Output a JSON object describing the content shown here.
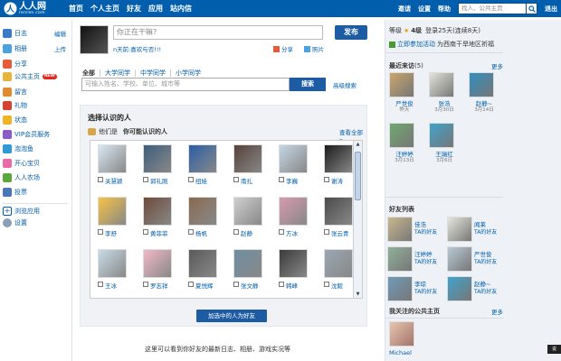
{
  "topbar": {
    "logo_text": "人人网",
    "logo_sub": "renren.com",
    "nav": [
      "首页",
      "个人主页",
      "好友",
      "应用",
      "站内信"
    ],
    "right_links": [
      "邀请",
      "设置",
      "帮助"
    ],
    "search_placeholder": "找人、公共主页",
    "logout": "退出"
  },
  "sidebar": {
    "edit": "编辑",
    "upload": "上传",
    "items": [
      {
        "label": "日志",
        "icon": "blog-icon",
        "color": "#3a79c9"
      },
      {
        "label": "相册",
        "icon": "album-icon",
        "color": "#4aa3df"
      },
      {
        "label": "分享",
        "icon": "share-icon",
        "color": "#e55c3a"
      },
      {
        "label": "公共主页",
        "icon": "page-icon",
        "color": "#e8b33a",
        "badge": "NEW"
      },
      {
        "label": "留言",
        "icon": "message-icon",
        "color": "#e58a2c"
      },
      {
        "label": "礼物",
        "icon": "gift-icon",
        "color": "#d8412f"
      },
      {
        "label": "状态",
        "icon": "status-icon",
        "color": "#f0b323"
      },
      {
        "label": "VIP会员服务",
        "icon": "vip-icon",
        "color": "#8b5bc9"
      },
      {
        "label": "泡泡鱼",
        "icon": "fish-icon",
        "color": "#2f98d6"
      },
      {
        "label": "开心宝贝",
        "icon": "baby-icon",
        "color": "#e86aa7"
      },
      {
        "label": "人人农场",
        "icon": "farm-icon",
        "color": "#5aa83b"
      },
      {
        "label": "投票",
        "icon": "vote-icon",
        "color": "#4a76b8"
      }
    ],
    "bottom_items": [
      {
        "label": "浏览应用",
        "icon": "browse-apps-icon"
      },
      {
        "label": "设置",
        "icon": "settings-icon"
      }
    ]
  },
  "main": {
    "status_placeholder": "你正在干嘛?",
    "status_line": "n天前:喜欢与否!!!",
    "publish": "发布",
    "share": "分享",
    "photo": "照片",
    "tabs": [
      "全部",
      "大学同学",
      "中学同学",
      "小学同学"
    ],
    "search_placeholder": "可输入姓名、学校、单位、城市等",
    "search_btn": "搜索",
    "advanced": "高级搜索",
    "panel_title": "选择认识的人",
    "panel_sub_a": "他们是",
    "panel_sub_b": "你可能认识的人",
    "see_all": "查看全部 »",
    "people": [
      "关慧颖",
      "郭礼刚",
      "纽娃",
      "南扎",
      "李巍",
      "谢涛",
      "李舒",
      "黄菲菲",
      "杨帆",
      "赵静",
      "方冰",
      "张云青",
      "王冰",
      "罗志祥",
      "夏悦辉",
      "张文静",
      "韩峰",
      "沈毅"
    ],
    "add_button": "加选中的人为好友",
    "bottom_text": "这里可以看到你好友的最新日志、相册、游戏实况等"
  },
  "rightbar": {
    "level_label": "等级",
    "level_value": "4级",
    "login_label": "登录",
    "login_days": "25天",
    "login_streak": "(连续8天)",
    "promo_link": "立即参加活动",
    "promo_text": "为西南干旱地区祈福",
    "recent_title": "最近来访",
    "recent_count": "(5)",
    "more": "更多",
    "visitors": [
      {
        "name": "严世俊",
        "date": "昨天"
      },
      {
        "name": "张浩",
        "date": "3月30日"
      },
      {
        "name": "赵静~",
        "date": "3月14日"
      },
      {
        "name": "汪婷婷",
        "date": "3月13日"
      },
      {
        "name": "王瑞红",
        "date": "3月6日"
      }
    ],
    "friends_title": "好友列表",
    "friends": [
      {
        "name": "佳浩",
        "sub": "TA的好友"
      },
      {
        "name": "闻莱",
        "sub": "TA的好友"
      },
      {
        "name": "汪婷婷",
        "sub": "TA的好友"
      },
      {
        "name": "严世俊",
        "sub": "TA的好友"
      },
      {
        "name": "李琼",
        "sub": "TA的好友"
      },
      {
        "name": "赵静~",
        "sub": "TA的好友"
      }
    ],
    "pages_title": "我关注的公共主页",
    "pages_more": "更多",
    "page_name": "Michael"
  },
  "corner": "说"
}
